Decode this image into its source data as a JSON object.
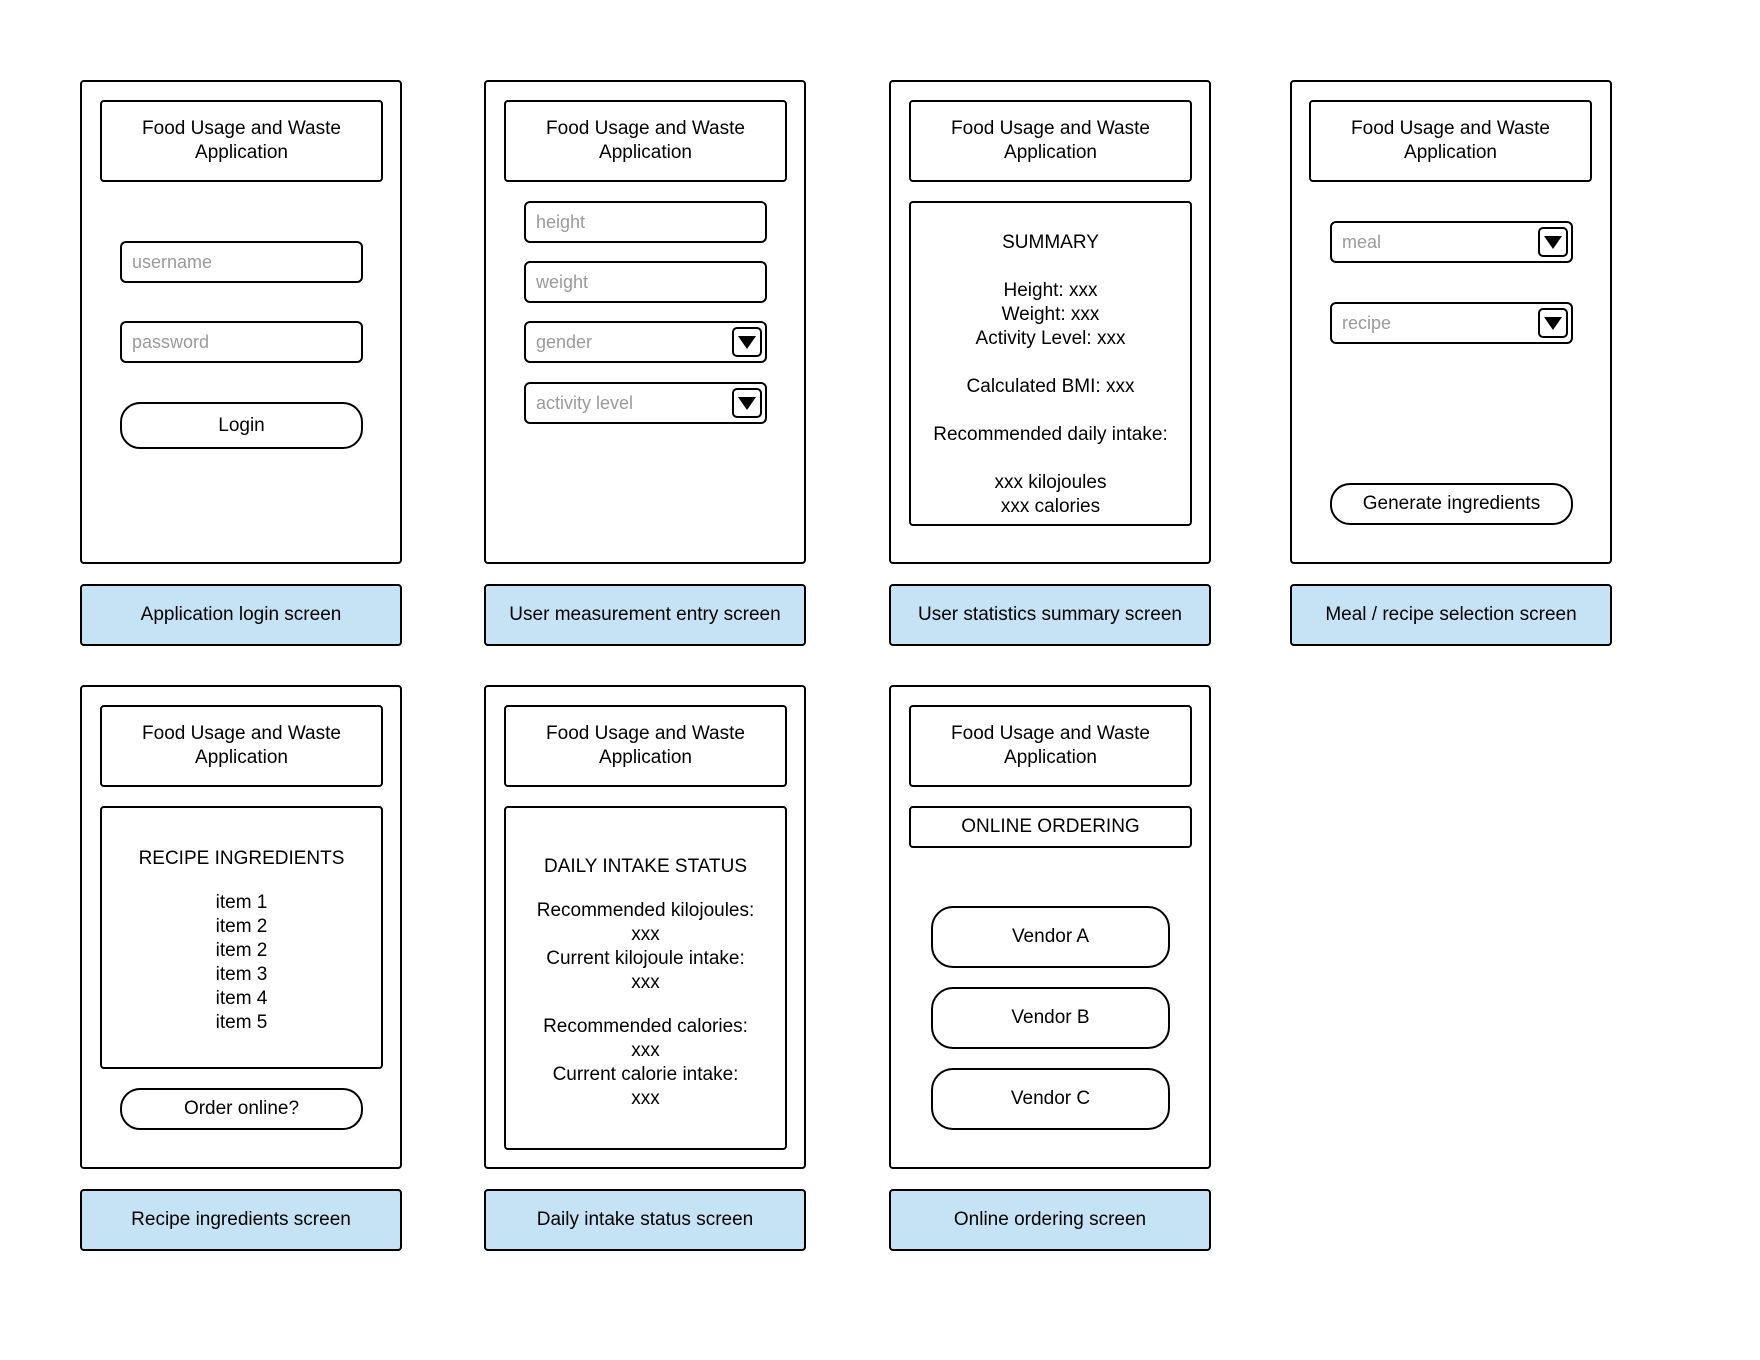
{
  "app_title": "Food Usage and Waste\nApplication",
  "screens": {
    "login": {
      "caption": "Application login screen",
      "username_placeholder": "username",
      "password_placeholder": "password",
      "login_label": "Login"
    },
    "measurement": {
      "caption": "User measurement entry screen",
      "height_placeholder": "height",
      "weight_placeholder": "weight",
      "gender_placeholder": "gender",
      "activity_placeholder": "activity level"
    },
    "summary": {
      "caption": "User statistics summary screen",
      "title": "SUMMARY",
      "height": "Height: xxx",
      "weight": "Weight: xxx",
      "activity": "Activity Level: xxx",
      "bmi": "Calculated BMI: xxx",
      "intake_label": "Recommended daily intake:",
      "kilojoules": "xxx kilojoules",
      "calories": "xxx calories"
    },
    "meal": {
      "caption": "Meal / recipe selection screen",
      "meal_placeholder": "meal",
      "recipe_placeholder": "recipe",
      "generate_label": "Generate ingredients"
    },
    "ingredients": {
      "caption": "Recipe ingredients screen",
      "title": "RECIPE INGREDIENTS",
      "items": [
        "item 1",
        "item 2",
        "item 2",
        "item 3",
        "item 4",
        "item 5"
      ],
      "order_label": "Order online?"
    },
    "daily": {
      "caption": "Daily intake status screen",
      "title": "DAILY INTAKE STATUS",
      "rec_kj_label": "Recommended kilojoules:",
      "rec_kj_value": "xxx",
      "cur_kj_label": "Current kilojoule intake:",
      "cur_kj_value": "xxx",
      "rec_cal_label": "Recommended calories:",
      "rec_cal_value": "xxx",
      "cur_cal_label": "Current calorie intake:",
      "cur_cal_value": "xxx"
    },
    "ordering": {
      "caption": "Online ordering screen",
      "title": "ONLINE ORDERING",
      "vendors": [
        "Vendor A",
        "Vendor B",
        "Vendor C"
      ]
    }
  },
  "colors": {
    "caption_fill": "#c5e3f5",
    "placeholder": "#9a9a9a"
  },
  "icons": {
    "dropdown": "triangle-down-icon"
  }
}
